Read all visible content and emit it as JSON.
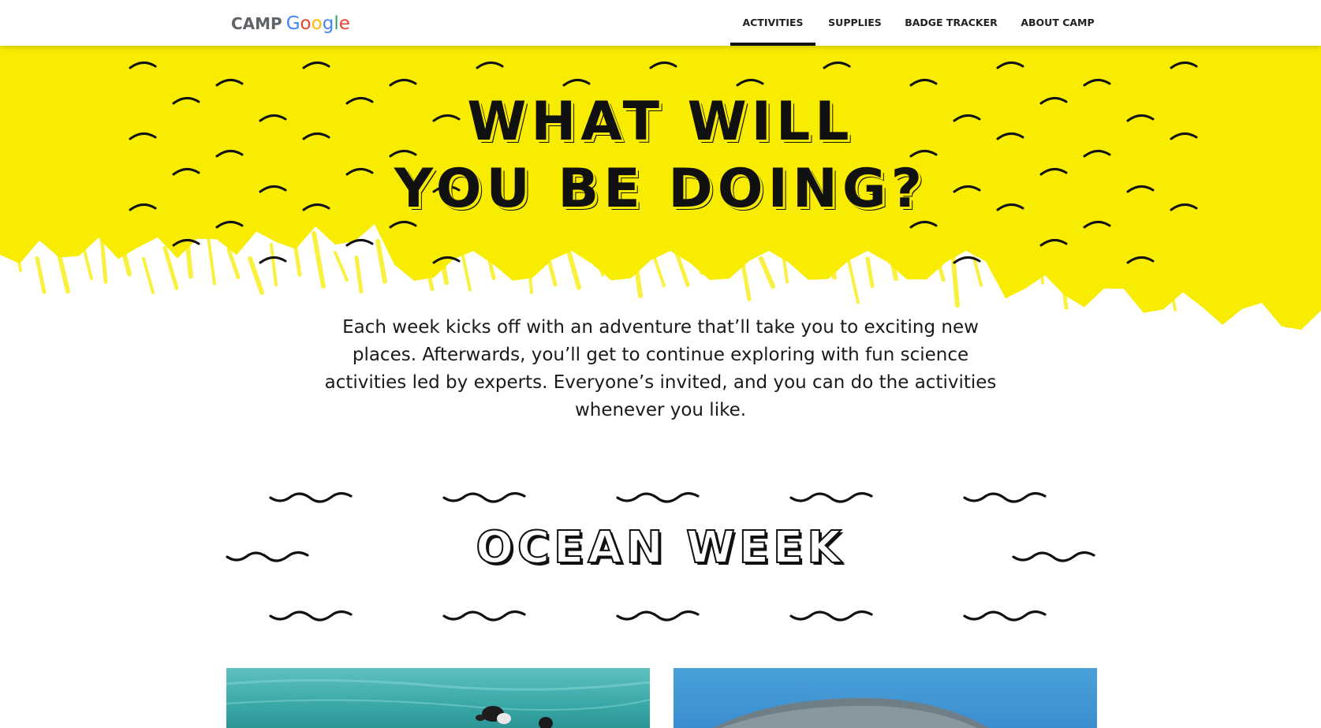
{
  "header": {
    "logo_prefix": "CAMP",
    "logo_letters": [
      "G",
      "o",
      "o",
      "g",
      "l",
      "e"
    ],
    "logo_colors": [
      "#4285F4",
      "#EA4335",
      "#FBBC05",
      "#4285F4",
      "#34A853",
      "#EA4335"
    ],
    "nav": [
      {
        "label": "ACTIVITIES",
        "active": true
      },
      {
        "label": "SUPPLIES",
        "active": false
      },
      {
        "label": "BADGE TRACKER",
        "active": false
      },
      {
        "label": "ABOUT CAMP",
        "active": false
      }
    ]
  },
  "hero": {
    "title_line1": "WHAT WILL",
    "title_line2": "YOU BE DOING?",
    "background_color": "#f8ec00",
    "intro": "Each week kicks off with an adventure that’ll take you to exciting new places. Afterwards, you’ll get to continue exploring with fun science activities led by experts. Everyone’s invited, and you can do the activities whenever you like."
  },
  "section": {
    "title": "OCEAN WEEK"
  },
  "cards": [
    {
      "image": "ocean-swimmers-photo"
    },
    {
      "image": "dolphin-photo"
    }
  ]
}
